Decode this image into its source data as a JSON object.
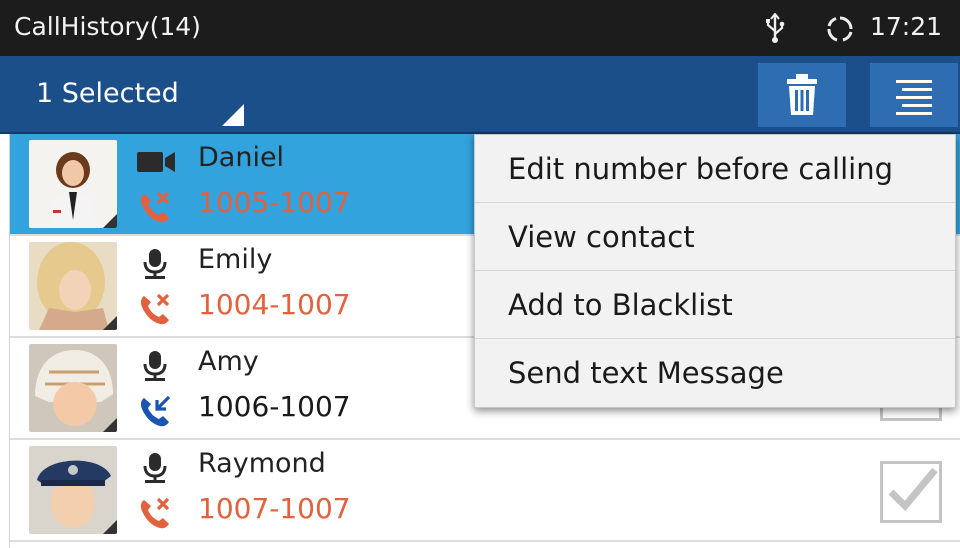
{
  "status_bar": {
    "title": "CallHistory(14)",
    "time": "17:21",
    "icons": [
      "usb-icon",
      "sync-icon"
    ]
  },
  "action_bar": {
    "selected_label": "1 Selected",
    "icons": [
      "trash-icon",
      "menu-icon"
    ],
    "color": "#1b4f8a"
  },
  "calls": [
    {
      "name": "Daniel",
      "number": "1005-1007",
      "type": "video-call-icon",
      "direction": "missed-call-icon",
      "selected": true
    },
    {
      "name": "Emily",
      "number": "1004-1007",
      "type": "audio-call-icon",
      "direction": "missed-call-icon",
      "selected": false
    },
    {
      "name": "Amy",
      "number": "1006-1007",
      "type": "audio-call-icon",
      "direction": "incoming-call-icon",
      "selected": false
    },
    {
      "name": "Raymond",
      "number": "1007-1007",
      "type": "audio-call-icon",
      "direction": "missed-call-icon",
      "selected": false
    }
  ],
  "context_menu": {
    "items": [
      {
        "label": "Edit number before calling"
      },
      {
        "label": "View contact"
      },
      {
        "label": "Add to Blacklist"
      },
      {
        "label": "Send text Message"
      }
    ]
  },
  "colors": {
    "selected_row": "#33a3dd",
    "missed": "#e2613e",
    "incoming": "#1a56b0"
  }
}
